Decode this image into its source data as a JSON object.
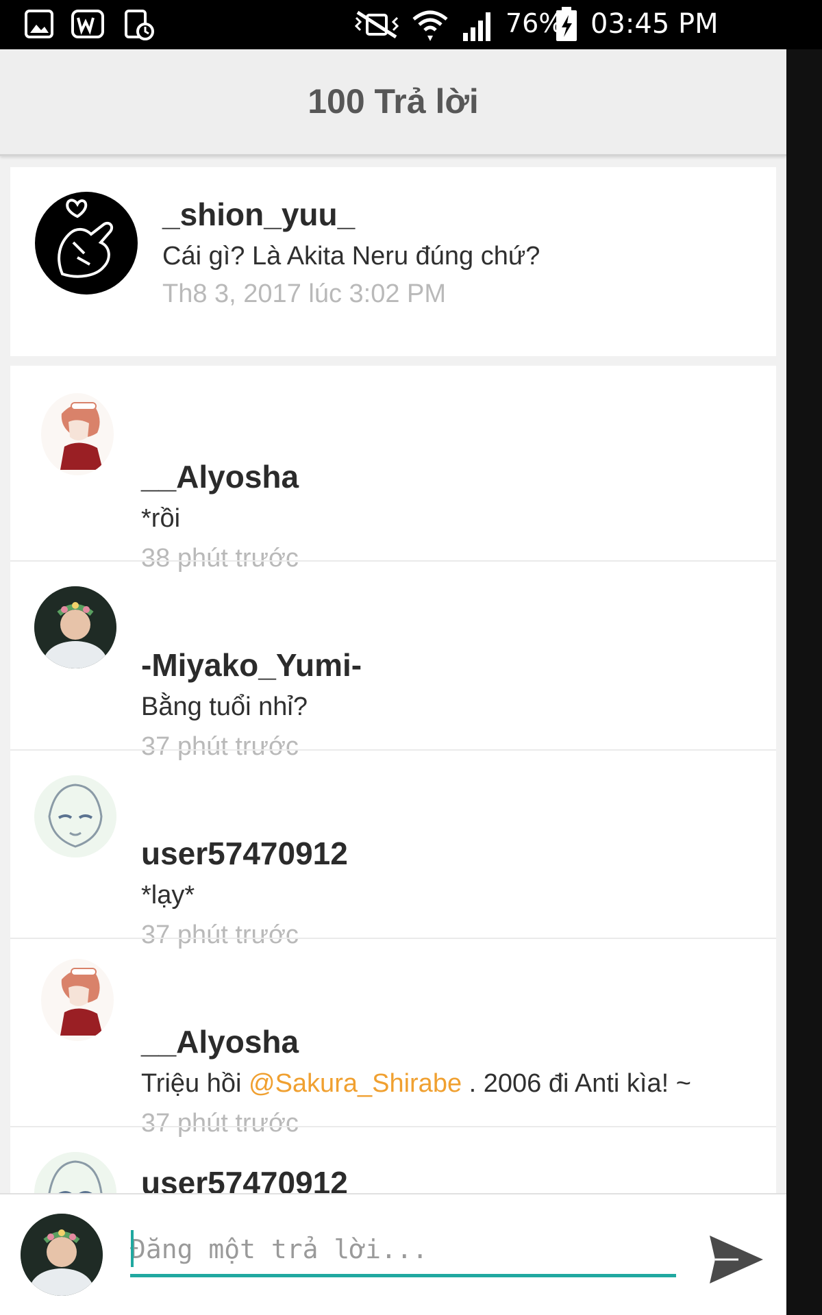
{
  "status_bar": {
    "battery": "76%",
    "time": "03:45 PM"
  },
  "header": {
    "title": "100 Trả lời"
  },
  "original_comment": {
    "username": "_shion_yuu_",
    "text": "Cái gì? Là Akita Neru đúng chứ?",
    "timestamp": "Th8 3, 2017 lúc 3:02 PM",
    "avatar_icon": "heart-hand-avatar"
  },
  "replies": [
    {
      "username": "__Alyosha",
      "text": "*rồi",
      "time": "38 phút trước",
      "avatar_icon": "anime-red-hair-avatar"
    },
    {
      "username": "-Miyako_Yumi-",
      "text": "Bằng tuổi nhỉ?",
      "time": "37 phút trước",
      "avatar_icon": "flower-crown-avatar"
    },
    {
      "username": "user57470912",
      "text": "*lạy*",
      "time": "37 phút trước",
      "avatar_icon": "anime-sketch-avatar"
    },
    {
      "username": "__Alyosha",
      "text_before": "Triệu hồi ",
      "mention": "@Sakura_Shirabe",
      "text_after": " . 2006 đi Anti kìa! ~",
      "time": "37 phút trước",
      "avatar_icon": "anime-red-hair-avatar"
    },
    {
      "username": "user57470912",
      "avatar_icon": "anime-sketch-avatar"
    }
  ],
  "composer": {
    "placeholder": "Đăng một trả lời...",
    "value": "",
    "avatar_icon": "flower-crown-avatar",
    "send_icon": "send-icon"
  },
  "colors": {
    "accent": "#20a8a0",
    "mention": "#f0a030",
    "timestamp": "#b9b9b9"
  }
}
